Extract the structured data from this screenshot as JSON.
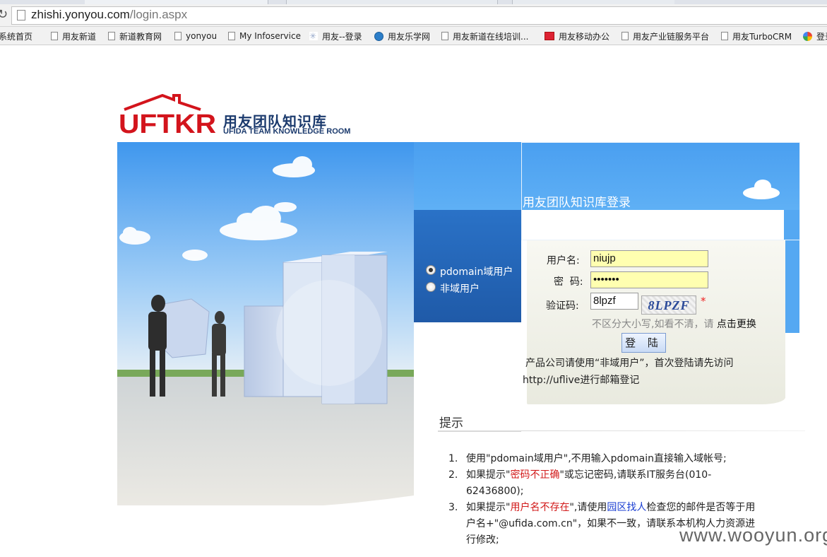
{
  "browser": {
    "url_host": "zhishi.yonyou.com",
    "url_path": "/login.aspx",
    "bookmarks": [
      {
        "label": "系统首页",
        "icon": "page-icon"
      },
      {
        "label": "用友新道",
        "icon": "page-icon"
      },
      {
        "label": "新道教育网",
        "icon": "page-icon"
      },
      {
        "label": "yonyou",
        "icon": "page-icon"
      },
      {
        "label": "My Infoservice",
        "icon": "page-icon"
      },
      {
        "label": "用友--登录",
        "icon": "star-icon"
      },
      {
        "label": "用友乐学网",
        "icon": "globe-icon"
      },
      {
        "label": "用友新道在线培训...",
        "icon": "page-icon"
      },
      {
        "label": "用友移动办公",
        "icon": "app-icon"
      },
      {
        "label": "用友产业链服务平台",
        "icon": "page-icon"
      },
      {
        "label": "用友TurboCRM",
        "icon": "page-icon"
      },
      {
        "label": "登录",
        "icon": "google-icon"
      }
    ]
  },
  "logo": {
    "mark": "UFTKR",
    "title_zh": "用友团队知识库",
    "title_en": "UFIDA TEAM KNOWLEDGE ROOM"
  },
  "login": {
    "title": "用友团队知识库登录",
    "radio_domain": "pdomain域用户",
    "radio_nondomain": "非域用户",
    "username_label": "用户名:",
    "username_value": "niujp",
    "password_label": "密  码:",
    "password_value": "•••••••",
    "captcha_label": "验证码:",
    "captcha_value": "8lpzf",
    "captcha_image_text": "8LPZF",
    "required_mark": "*",
    "hint": "不区分大小写,如看不清，请",
    "hint_link": "点击更换",
    "button": "登 陆",
    "note_line1": "产品公司请使用“非域用户”，首次登陆请先访问",
    "note_line2": "http://uflive进行邮箱登记"
  },
  "tips": {
    "title": "提示",
    "item1_num": "1.",
    "item1": "使用\"pdomain域用户\",不用输入pdomain直接输入域帐号;",
    "item2_num": "2.",
    "item2_pre": "如果提示\"",
    "item2_red": "密码不正确",
    "item2_post": "\"或忘记密码,请联系IT服务台(010-",
    "item2_line2": "62436800);",
    "item3_num": "3.",
    "item3_pre": "如果提示\"",
    "item3_red": "用户名不存在",
    "item3_mid": "\",请使用",
    "item3_blue": "园区找人",
    "item3_post": "检查您的邮件是否等于用",
    "item3_line2": "户名+\"@ufida.com.cn\"，如果不一致，请联系本机构人力资源进",
    "item3_line3": "行修改;"
  },
  "watermark": "www.wooyun.org",
  "colors": {
    "brand_red": "#d3141c",
    "brand_navy": "#1b3a6d",
    "sky_blue": "#4a9ff0",
    "panel_blue": "#2563b8",
    "input_yellow": "#ffffb0"
  }
}
